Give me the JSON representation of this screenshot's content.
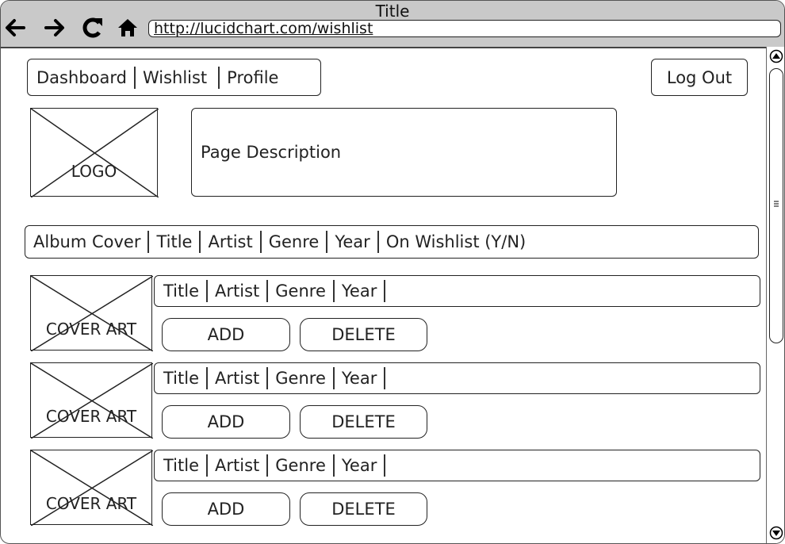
{
  "window": {
    "title": "Title",
    "url": "http://lucidchart.com/wishlist"
  },
  "toolbar_icons": [
    "back-arrow-icon",
    "forward-arrow-icon",
    "refresh-icon",
    "home-icon"
  ],
  "nav": {
    "items": [
      "Dashboard",
      "Wishlist",
      "Profile"
    ]
  },
  "logout_label": "Log Out",
  "logo_label": "LOGO",
  "page_description": "Page Description",
  "table_header": [
    "Album Cover",
    "Title",
    "Artist",
    "Genre",
    "Year",
    "On Wishlist (Y/N)"
  ],
  "albums": [
    {
      "cover_label": "COVER ART",
      "fields": [
        "Title",
        "Artist",
        "Genre",
        "Year"
      ],
      "add_label": "ADD",
      "delete_label": "DELETE"
    },
    {
      "cover_label": "COVER ART",
      "fields": [
        "Title",
        "Artist",
        "Genre",
        "Year"
      ],
      "add_label": "ADD",
      "delete_label": "DELETE"
    },
    {
      "cover_label": "COVER ART",
      "fields": [
        "Title",
        "Artist",
        "Genre",
        "Year"
      ],
      "add_label": "ADD",
      "delete_label": "DELETE"
    }
  ]
}
